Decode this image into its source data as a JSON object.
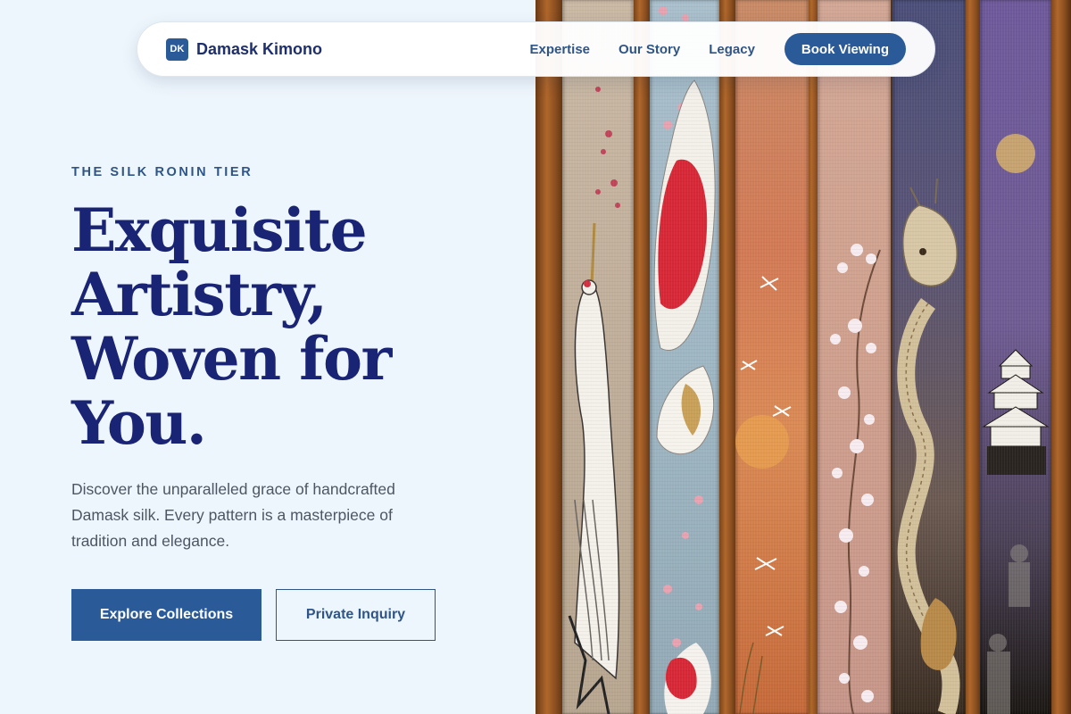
{
  "colors": {
    "accent": "#2a5a98",
    "headline": "#1a2474",
    "brand_text": "#1e2f6e",
    "link": "#2f5586",
    "body_text": "#4d5662",
    "background": "#eef6fd"
  },
  "nav": {
    "brand_badge": "DK",
    "brand_name": "Damask Kimono",
    "links": [
      "Expertise",
      "Our Story",
      "Legacy"
    ],
    "cta_label": "Book Viewing"
  },
  "hero": {
    "eyebrow": "THE SILK RONIN TIER",
    "headline_lines": [
      "Exquisite",
      "Artistry,",
      "Woven for",
      "You."
    ],
    "lead": "Discover the unparalleled grace of handcrafted Damask silk. Every pattern is a masterpiece of tradition and elegance.",
    "primary_button": "Explore Collections",
    "secondary_button": "Private Inquiry"
  },
  "image": {
    "alt": "Hand-painted kimono silk banners with crane, koi, cherry blossom, dragon and castle motifs",
    "motifs": [
      "crane",
      "koi",
      "dragonfly",
      "cherry-blossom",
      "dragon",
      "castle",
      "moon"
    ]
  }
}
